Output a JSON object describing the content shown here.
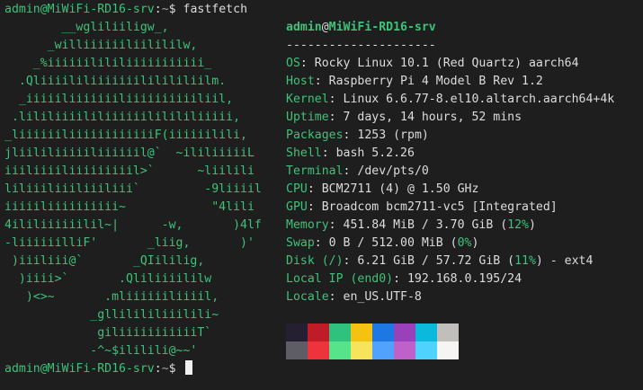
{
  "prompt_top": {
    "user_host": "admin@MiWiFi-RD16-srv",
    "sep": ":",
    "path": "~",
    "symbol": "$",
    "command": "fastfetch"
  },
  "prompt_bottom": {
    "user_host": "admin@MiWiFi-RD16-srv",
    "sep": ":",
    "path": "~",
    "symbol": "$"
  },
  "logo_lines": [
    "        __wgliliiligw_,",
    "      _williiiiiiliilililw,",
    "    _%iiiiiilililiiiiiiiiiii_",
    "  .Qliiiililiiiiiiililililiilm.",
    "  _iiiiiliiiiiiiliiiiiiiiiiliil,",
    " .lililiiiililiiiiiililililiiiii,",
    "_liiiiiiliiiiiiiiiiiiF(iiiiiilili,",
    "jliililiiiiiliiiiiil@`  ~ililiiiiiL",
    "iiiliiiiliiiiiiiiil>`      ~liilili",
    "liliiiliiiliiiliii`         -9liiiil",
    "iiiiiliiiiiiiiii~            \"4lili",
    "4ililiiiiiilil~|      -w,       )4lf",
    "-liiiiiilliF'       _liig,       )'",
    " )iiiliii@`       _QIililig,",
    "  )iiii>`       .Qliliiiililw",
    "   )<>~       .mliiiiiiliiiil,",
    "            _gllilililiiilili~",
    "             giliiiiiiiiiiiT`",
    "            -^~$ililili@~~'"
  ],
  "title": {
    "user": "admin",
    "at": "@",
    "host": "MiWiFi-RD16-srv",
    "separator": "---------------------"
  },
  "info": [
    {
      "key": "OS",
      "value": "Rocky Linux 10.1 (Red Quartz) aarch64"
    },
    {
      "key": "Host",
      "value": "Raspberry Pi 4 Model B Rev 1.2"
    },
    {
      "key": "Kernel",
      "value": "Linux 6.6.77-8.el10.altarch.aarch64+4k"
    },
    {
      "key": "Uptime",
      "value": "7 days, 14 hours, 52 mins"
    },
    {
      "key": "Packages",
      "value": "1253 (rpm)"
    },
    {
      "key": "Shell",
      "value": "bash 5.2.26"
    },
    {
      "key": "Terminal",
      "value": "/dev/pts/0"
    },
    {
      "key": "CPU",
      "value": "BCM2711 (4) @ 1.50 GHz"
    },
    {
      "key": "GPU",
      "value": "Broadcom bcm2711-vc5 [Integrated]"
    }
  ],
  "memory": {
    "key": "Memory",
    "value": "451.84 MiB / 3.70 GiB (",
    "pct": "12%",
    "tail": ")"
  },
  "swap": {
    "key": "Swap",
    "value": "0 B / 512.00 MiB (",
    "pct": "0%",
    "tail": ")"
  },
  "disk": {
    "key": "Disk (/)",
    "value": "6.21 GiB / 57.72 GiB (",
    "pct": "11%",
    "tail": ") - ext4"
  },
  "local_ip": {
    "key": "Local IP (end0)",
    "value": "192.168.0.195/24"
  },
  "locale": {
    "key": "Locale",
    "value": "en_US.UTF-8"
  },
  "colors": {
    "background": "#1e1e1e",
    "accent_green": "#3ec27a",
    "text": "#dcdcdc",
    "palette_row1": [
      "#241f31",
      "#c01c28",
      "#2ec27e",
      "#f5c211",
      "#1e78e4",
      "#9841bb",
      "#0ab9dc",
      "#c0bfbc"
    ],
    "palette_row2": [
      "#5e5c64",
      "#ed333b",
      "#57e389",
      "#f8e45c",
      "#51a1ff",
      "#c061cb",
      "#4fd2fd",
      "#f6f5f4"
    ]
  }
}
